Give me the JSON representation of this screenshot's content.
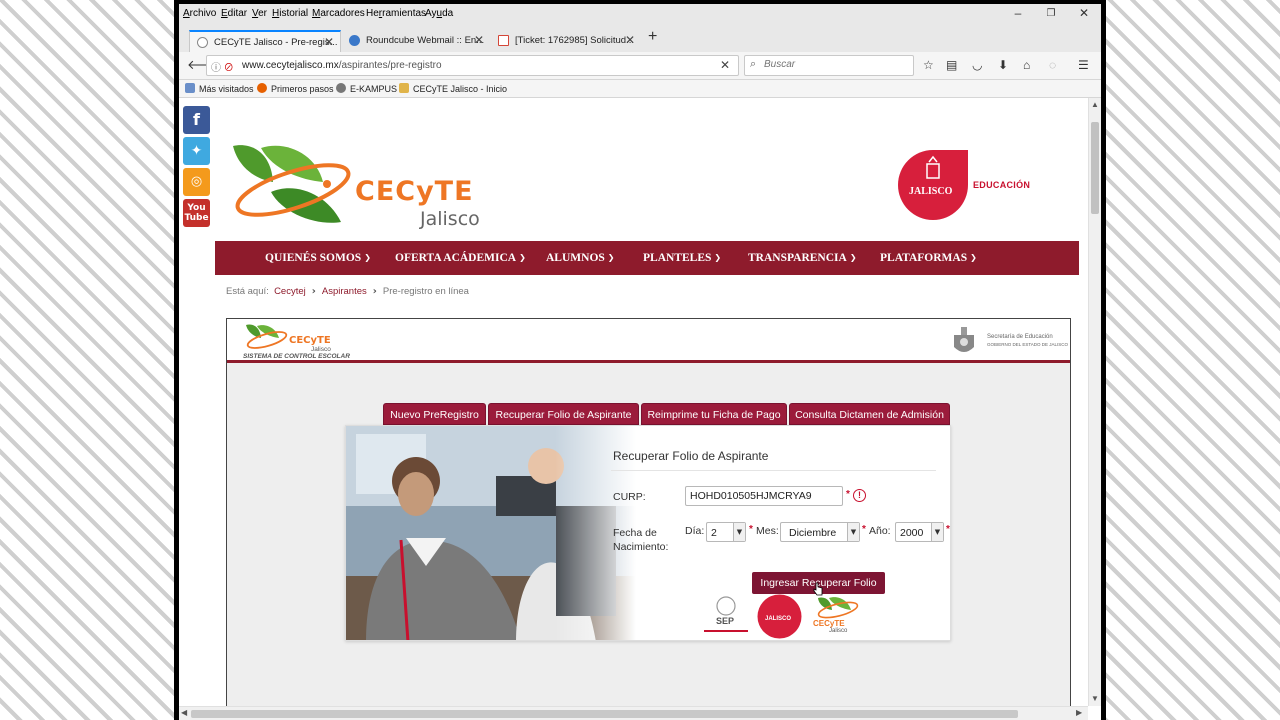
{
  "browser": {
    "menus": [
      {
        "pre": "",
        "u": "A",
        "post": "rchivo"
      },
      {
        "pre": "",
        "u": "E",
        "post": "ditar"
      },
      {
        "pre": "",
        "u": "V",
        "post": "er"
      },
      {
        "pre": "",
        "u": "H",
        "post": "istorial"
      },
      {
        "pre": "",
        "u": "M",
        "post": "arcadores"
      },
      {
        "pre": "He",
        "u": "r",
        "post": "ramientas"
      },
      {
        "pre": "Ay",
        "u": "u",
        "post": "da"
      }
    ],
    "tabs": [
      {
        "title": "CECyTE Jalisco - Pre-regis...",
        "active": true,
        "icon_color": "#9aa5b1"
      },
      {
        "title": "Roundcube Webmail :: En...",
        "active": false,
        "icon_color": "#3a78c9"
      },
      {
        "title": "[Ticket: 1762985] Solicitud...",
        "active": false,
        "icon_color": "#d44638"
      }
    ],
    "url_host": "www.cecytejalisco.mx",
    "url_path": "/aspirantes/pre-registro",
    "search_placeholder": "Buscar",
    "bookmarks": [
      {
        "label": "Más visitados",
        "icon_color": "#6a8fc9"
      },
      {
        "label": "Primeros pasos",
        "icon_color": "#e66000"
      },
      {
        "label": "E-KAMPUS",
        "icon_color": "#777777"
      },
      {
        "label": "CECyTE Jalisco - Inicio",
        "icon_color": "#e0b44a"
      }
    ]
  },
  "social": [
    {
      "name": "facebook",
      "label": "f",
      "color": "#3b5998"
    },
    {
      "name": "twitter",
      "label": "t",
      "color": "#3fa9e0"
    },
    {
      "name": "rss",
      "label": "◎",
      "color": "#f49a1c"
    },
    {
      "name": "youtube",
      "label": "You\nTube",
      "color": "#c4302b"
    }
  ],
  "header": {
    "brand_word": "CECyTE",
    "brand_sub": "Jalisco",
    "jalisco_word": "JALISCO",
    "educacion": "EDUCACIÓN"
  },
  "nav": [
    "QUIENÉS SOMOS",
    "OFERTA ACÁDEMICA",
    "ALUMNOS",
    "PLANTELES",
    "TRANSPARENCIA",
    "PLATAFORMAS"
  ],
  "breadcrumb": {
    "prefix": "Está aquí:",
    "items": [
      "Cecytej",
      "Aspirantes",
      "Pre-registro en línea"
    ]
  },
  "system": {
    "mini_word": "CECyTE",
    "mini_sub": "Jalisco",
    "caption": "SISTEMA DE CONTROL ESCOLAR",
    "sep_line1": "Secretaría de Educación",
    "sep_line2": "GOBIERNO DEL ESTADO DE JALISCO",
    "tabs": [
      "Nuevo PreRegistro",
      "Recuperar Folio de Aspirante",
      "Reimprime tu Ficha de Pago",
      "Consulta Dictamen de Admisión"
    ],
    "form": {
      "title": "Recuperar Folio de Aspirante",
      "curp_label": "CURP:",
      "curp_value": "HOHD010505HJMCRYA9",
      "birth_label_1": "Fecha de",
      "birth_label_2": "Nacimiento:",
      "dia_label": "Día:",
      "dia_value": "2",
      "mes_label": "Mes:",
      "mes_value": "Diciembre",
      "anio_label": "Año:",
      "anio_value": "2000",
      "required_mark": "*",
      "submit_label": "Ingresar Recuperar Folio"
    },
    "footer": {
      "sep_label": "SEP",
      "jalisco_label": "JALISCO",
      "cecyte_label": "CECyTE",
      "cecyte_sub": "Jalisco"
    }
  },
  "colors": {
    "brand_red": "#8e1b2c",
    "tab_red": "#9b1b3b",
    "cecyte_orange": "#ee7624",
    "cecyte_green": "#5a9a2a",
    "jalisco_red": "#c8102e"
  }
}
